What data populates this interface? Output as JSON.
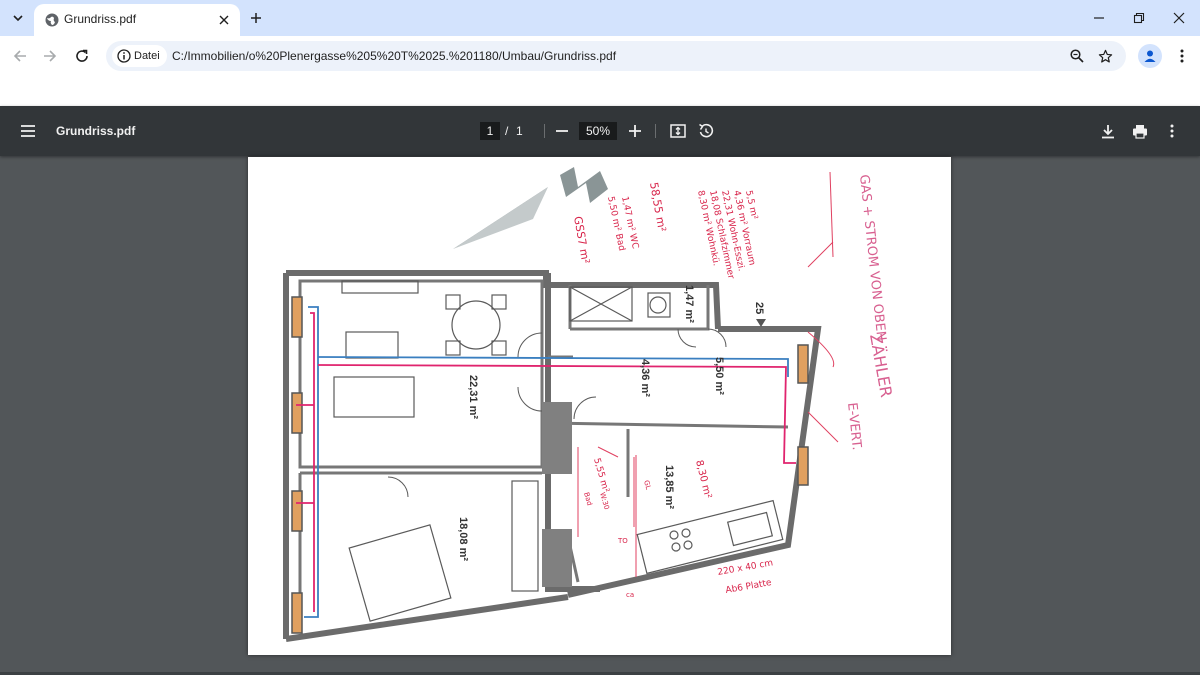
{
  "browser": {
    "tab": {
      "title": "Grundriss.pdf"
    },
    "address": {
      "chip_label": "Datei",
      "url": "C:/Immobilien/o%20Plenergasse%205%20T%2025.%201180/Umbau/Grundriss.pdf"
    },
    "icons": {
      "tab_search": "chevron-down-icon",
      "favicon": "globe-icon",
      "close": "close-icon",
      "new_tab": "plus-icon",
      "back": "back-arrow-icon",
      "forward": "forward-arrow-icon",
      "reload": "reload-icon",
      "zoom": "zoom-icon",
      "bookmark": "star-icon",
      "profile": "profile-icon",
      "menu": "more-vert-icon"
    }
  },
  "pdf_viewer": {
    "title": "Grundriss.pdf",
    "page_current": "1",
    "page_separator": "/",
    "page_total": "1",
    "zoom": "50%",
    "icons": [
      "menu-icon",
      "zoom-out-icon",
      "zoom-in-icon",
      "fit-page-icon",
      "rotate-icon",
      "download-icon",
      "print-icon",
      "more-vert-icon"
    ]
  },
  "floorplan": {
    "rooms": [
      {
        "area": "22,31 m²"
      },
      {
        "area": "18,08 m²"
      },
      {
        "area": "4,36 m²"
      },
      {
        "area": "5,50 m²"
      },
      {
        "area": "13,85 m²"
      },
      {
        "area": "1,47 m²"
      }
    ],
    "stair_label": "25",
    "annotations": {
      "notes_list": [
        "5,5 m²",
        "4,36 m² Vorraum",
        "22,31 Wohn-Esszi.",
        "18,08 Schlafzimmer",
        "8,30 m² Wohnkü."
      ],
      "total_1": "58,55 m²",
      "area_col": [
        "1,47 m² WC",
        "5,50 m² Bad",
        "GSS7 m²"
      ],
      "gas_note": "GAS + STROM VON OBEN",
      "meter_note": "ZÄHLER",
      "everteiler": "E-VERT.",
      "bath_area": "5,55 m²",
      "kitchen_area": "8,30 m²",
      "kitchen_dim": "220 x 40 cm",
      "plate_note": "Ab6 Platte",
      "small_a": "Bad",
      "small_b": "W:30",
      "small_c": "TO",
      "small_d": "GL",
      "small_e": "ca"
    }
  }
}
